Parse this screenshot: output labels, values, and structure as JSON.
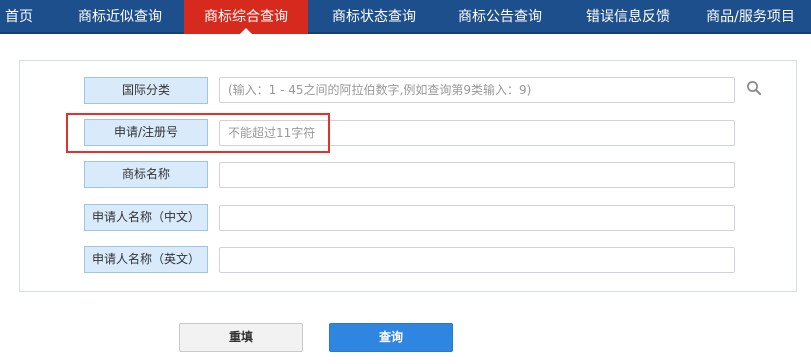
{
  "nav": {
    "items": [
      {
        "label": "首页"
      },
      {
        "label": "商标近似查询"
      },
      {
        "label": "商标综合查询"
      },
      {
        "label": "商标状态查询"
      },
      {
        "label": "商标公告查询"
      },
      {
        "label": "错误信息反馈"
      },
      {
        "label": "商品/服务项目"
      }
    ],
    "active_label": "商标综合查询"
  },
  "form": {
    "fields": [
      {
        "label": "国际分类",
        "value": "",
        "placeholder": "(输入：1 - 45之间的阿拉伯数字,例如查询第9类输入：9)"
      },
      {
        "label": "申请/注册号",
        "value": "",
        "placeholder": "不能超过11字符"
      },
      {
        "label": "商标名称",
        "value": "",
        "placeholder": ""
      },
      {
        "label": "申请人名称（中文）",
        "value": "",
        "placeholder": ""
      },
      {
        "label": "申请人名称（英文）",
        "value": "",
        "placeholder": ""
      }
    ],
    "search_icon": "search-icon",
    "highlighted_field": "申请/注册号"
  },
  "buttons": {
    "reset_label": "重填",
    "query_label": "查询"
  },
  "colors": {
    "nav_bg": "#1d4f8c",
    "nav_active": "#d62a1e",
    "label_bg": "#d9ebfb",
    "query_btn": "#2f86e0",
    "highlight": "#e0332b"
  }
}
